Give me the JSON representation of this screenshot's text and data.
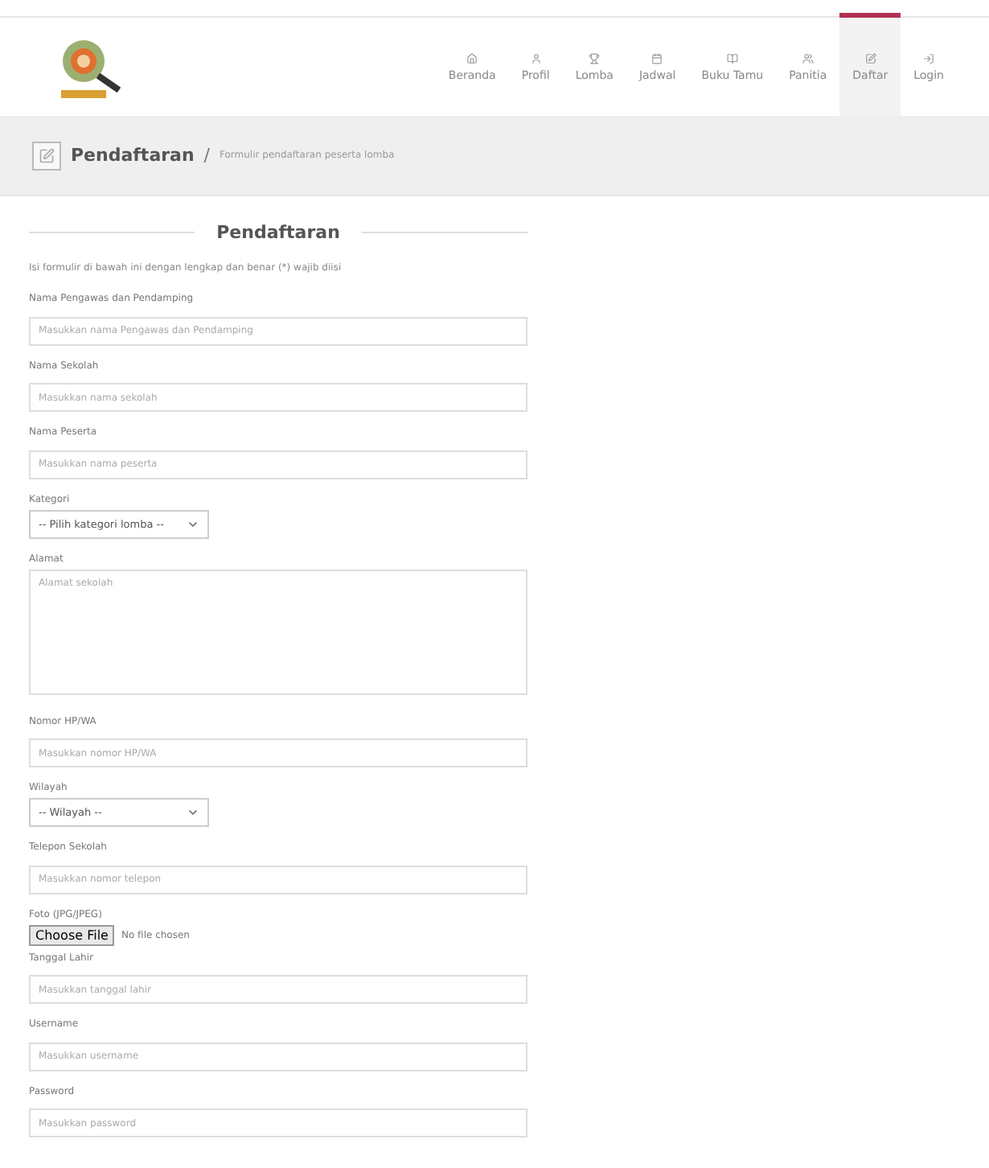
{
  "nav": [
    {
      "label": "Beranda",
      "selected": false
    },
    {
      "label": "Profil",
      "selected": false
    },
    {
      "label": "Lomba",
      "selected": false
    },
    {
      "label": "Jadwal",
      "selected": false
    },
    {
      "label": "Buku Tamu",
      "selected": false
    },
    {
      "label": "Panitia",
      "selected": false
    },
    {
      "label": "Daftar",
      "selected": true
    },
    {
      "label": "Login",
      "selected": false
    }
  ],
  "breadcrumb": {
    "title": "Pendaftaran",
    "separator": "/",
    "subtitle": "Formulir pendaftaran peserta lomba"
  },
  "form": {
    "title": "Pendaftaran",
    "intro": "Isi formulir di bawah ini dengan lengkap dan benar (*) wajib diisi",
    "fields": [
      {
        "kind": "text",
        "label": "Nama Pengawas dan Pendamping",
        "placeholder": "Masukkan nama Pengawas dan Pendamping"
      },
      {
        "kind": "text",
        "label": "Nama Sekolah",
        "placeholder": "Masukkan nama sekolah"
      },
      {
        "kind": "text",
        "label": "Nama Peserta",
        "placeholder": "Masukkan nama peserta"
      },
      {
        "kind": "select",
        "label": "Kategori",
        "value": "-- Pilih kategori lomba --"
      },
      {
        "kind": "textarea",
        "label": "Alamat",
        "placeholder": "Alamat sekolah"
      },
      {
        "kind": "text",
        "label": "Nomor HP/WA",
        "placeholder": "Masukkan nomor HP/WA"
      },
      {
        "kind": "select",
        "label": "Wilayah",
        "value": "-- Wilayah --"
      },
      {
        "kind": "text",
        "label": "Telepon Sekolah",
        "placeholder": "Masukkan nomor telepon"
      },
      {
        "kind": "file",
        "label": "Foto (JPG/JPEG)",
        "button": "Choose File",
        "value": "No file chosen"
      },
      {
        "kind": "text",
        "label": "Tanggal Lahir",
        "placeholder": "Masukkan tanggal lahir"
      },
      {
        "kind": "text",
        "label": "Username",
        "placeholder": "Masukkan username"
      },
      {
        "kind": "text",
        "label": "Password",
        "placeholder": "Masukkan password"
      }
    ]
  }
}
